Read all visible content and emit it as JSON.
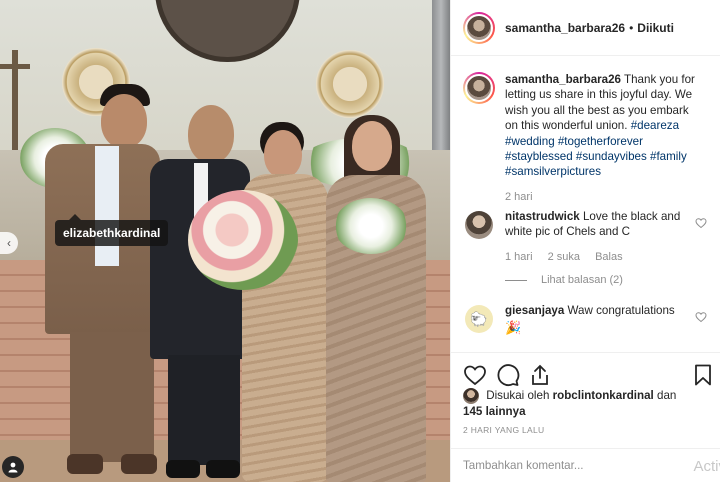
{
  "photo": {
    "tag_label": "elizabethkardinal",
    "prev_arrow": "‹"
  },
  "header": {
    "username": "samantha_barbara26",
    "separator": "•",
    "follow_status": "Diikuti"
  },
  "caption": {
    "username": "samantha_barbara26",
    "text": "Thank you for letting us share in this joyful day. We wish you all the best as you embark on this wonderful union.",
    "hashtags": "#deareza #wedding #togetherforever #stayblessed #sundayvibes #family #samsilverpictures",
    "time": "2 hari"
  },
  "comments": [
    {
      "username": "nitastrudwick",
      "text": "Love the black and white pic of Chels and C",
      "time": "1 hari",
      "likes": "2 suka",
      "reply": "Balas",
      "view_replies": "Lihat balasan (2)"
    },
    {
      "username": "giesanjaya",
      "text": "Waw congratulations",
      "emoji": "🎉"
    }
  ],
  "likes": {
    "prefix": "Disukai oleh",
    "user": "robclintonkardinal",
    "joiner": "dan",
    "others": "145 lainnya"
  },
  "post_time": "2 HARI YANG LALU",
  "comment_input": {
    "placeholder": "Tambahkan komentar..."
  },
  "watermark": "Activ",
  "icons": [
    "heart-icon",
    "comment-icon",
    "share-icon",
    "bookmark-icon",
    "user-tag-icon"
  ],
  "colors": {
    "hashtag": "#003569",
    "muted": "#8e8e8e",
    "border": "#efefef"
  }
}
